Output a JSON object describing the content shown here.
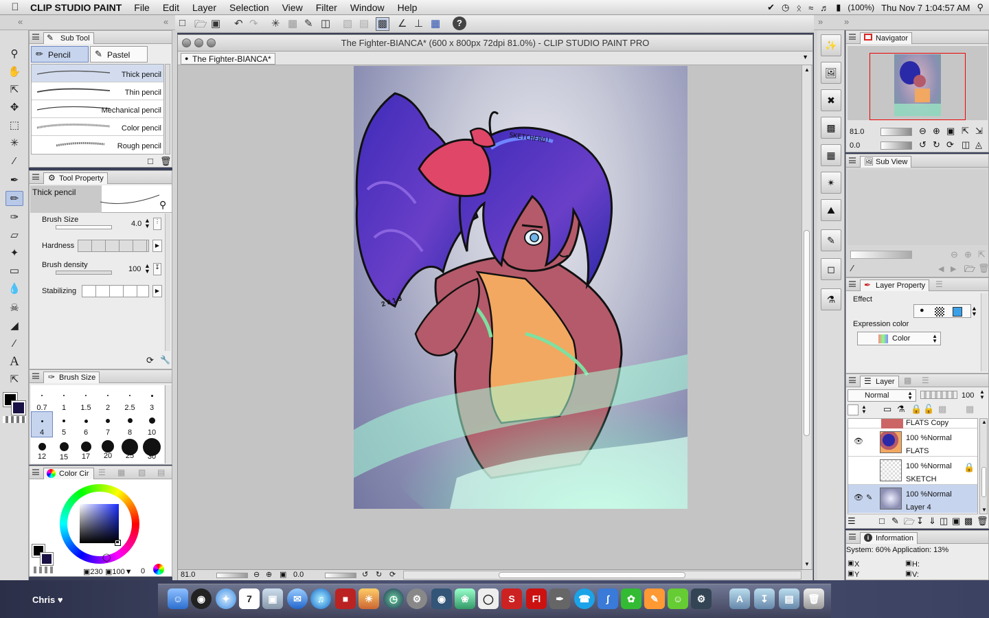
{
  "menubar": {
    "app_name": "CLIP STUDIO PAINT",
    "menus": [
      "File",
      "Edit",
      "Layer",
      "Selection",
      "View",
      "Filter",
      "Window",
      "Help"
    ],
    "battery": "(100%)",
    "datetime": "Thu Nov 7  1:04:57 AM"
  },
  "subtool": {
    "tab": "Sub Tool",
    "groups": [
      "Pencil",
      "Pastel"
    ],
    "items": [
      "Thick pencil",
      "Thin pencil",
      "Mechanical pencil",
      "Color pencil",
      "Rough pencil"
    ]
  },
  "toolprop": {
    "tab": "Tool Property",
    "preset_name": "Thick pencil",
    "brush_size_label": "Brush Size",
    "brush_size_value": "4.0",
    "hardness_label": "Hardness",
    "density_label": "Brush density",
    "density_value": "100",
    "stabilizing_label": "Stabilizing"
  },
  "brushsize": {
    "tab": "Brush Size",
    "sizes": [
      "0.7",
      "1",
      "1.5",
      "2",
      "2.5",
      "3",
      "4",
      "5",
      "6",
      "7",
      "8",
      "10",
      "12",
      "15",
      "17",
      "20",
      "25",
      "30"
    ]
  },
  "colorcircle": {
    "tab": "Color Cir",
    "h": "230",
    "s": "100",
    "v": "0",
    "main_color": "#000000",
    "sub_color": "#1a1244"
  },
  "document": {
    "window_title": "The Fighter-BIANCA* (600 x 800px 72dpi 81.0%)  - CLIP STUDIO PAINT PRO",
    "tab": "The Fighter-BIANCA*",
    "zoom": "81.0",
    "rotation": "0.0",
    "signature": "SKETCHFRO!",
    "year": "2 0 1 3"
  },
  "navigator": {
    "tab": "Navigator",
    "zoom": "81.0",
    "rotation": "0.0"
  },
  "subview": {
    "tab": "Sub View"
  },
  "layerprop": {
    "tab": "Layer Property",
    "effect_label": "Effect",
    "expression_label": "Expression color",
    "expression_value": "Color"
  },
  "layer": {
    "tab": "Layer",
    "blend": "Normal",
    "opacity": "100",
    "layers": [
      {
        "name": "FLATS Copy",
        "mode": ""
      },
      {
        "name": "FLATS",
        "mode": "100 %Normal"
      },
      {
        "name": "SKETCH",
        "mode": "100 %Normal"
      },
      {
        "name": "Layer 4",
        "mode": "100 %Normal"
      }
    ]
  },
  "info": {
    "tab": "Information",
    "system": "System: 60% Application: 13%",
    "x_label": "X",
    "y_label": "Y",
    "h_label": "H:",
    "v_label": "V:"
  },
  "desktop": {
    "user": "Chris ♥"
  },
  "dock": {
    "flash_label": "Fl"
  },
  "colors": {
    "selection": "#b8c8e8",
    "hair": "#2a2aa8",
    "skin": "#b55a6a",
    "shirt": "#f2a860",
    "glow": "#7ff0c0"
  }
}
